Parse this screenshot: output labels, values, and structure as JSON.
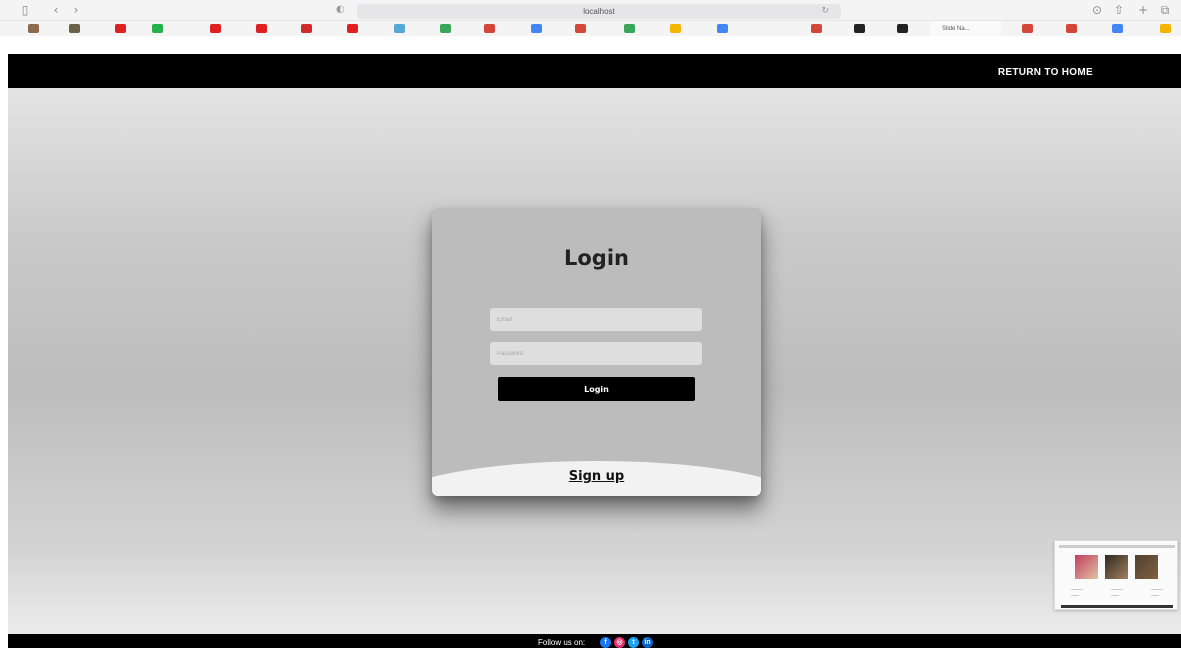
{
  "browser": {
    "url": "localhost",
    "active_tab_label": "Slide Na...",
    "favorites": [
      {
        "icon": "cc-icon",
        "color": "#8b6a4f"
      },
      {
        "icon": "cc-icon",
        "color": "#6b6048"
      },
      {
        "icon": "youtube-icon",
        "color": "#e02020"
      },
      {
        "icon": "whatsapp-icon",
        "color": "#25b04c"
      },
      {
        "icon": "youtube-icon",
        "color": "#e02020"
      },
      {
        "icon": "youtube-icon",
        "color": "#e02020"
      },
      {
        "icon": "gear-icon",
        "color": "#d02a2a"
      },
      {
        "icon": "youtube-icon",
        "color": "#e02020"
      },
      {
        "icon": "globe-icon",
        "color": "#56a8d8"
      },
      {
        "icon": "sheets-icon",
        "color": "#3aa65a"
      },
      {
        "icon": "gmail-icon",
        "color": "#d44638"
      },
      {
        "icon": "google-icon",
        "color": "#4285f4"
      },
      {
        "icon": "gmail-icon",
        "color": "#d44638"
      },
      {
        "icon": "sheets-icon",
        "color": "#3aa65a"
      },
      {
        "icon": "slides-icon",
        "color": "#f4b400"
      },
      {
        "icon": "docs-icon",
        "color": "#4285f4"
      },
      {
        "icon": "gmail-icon",
        "color": "#d44638"
      },
      {
        "icon": "github-icon",
        "color": "#222222"
      },
      {
        "icon": "github-icon",
        "color": "#222222"
      },
      {
        "icon": "gmail-icon",
        "color": "#d44638"
      },
      {
        "icon": "gmail-icon",
        "color": "#d44638"
      },
      {
        "icon": "google-icon",
        "color": "#4285f4"
      },
      {
        "icon": "drive-icon",
        "color": "#f4b400"
      }
    ]
  },
  "header": {
    "return_home": "RETURN TO HOME"
  },
  "login": {
    "title": "Login",
    "email_placeholder": "Email",
    "password_placeholder": "Password",
    "button_label": "Login",
    "signup_label": "Sign up"
  },
  "footer": {
    "follow_label": "Follow us on:",
    "social_icons": [
      "facebook-icon",
      "instagram-icon",
      "twitter-icon",
      "linkedin-icon"
    ]
  },
  "colors": {
    "header_bg": "#000000",
    "card_bg": "#bcbcbc",
    "button_bg": "#000000",
    "facebook": "#1877f2",
    "instagram": "#e1306c",
    "twitter": "#1da1f2",
    "linkedin": "#0a66c2"
  }
}
